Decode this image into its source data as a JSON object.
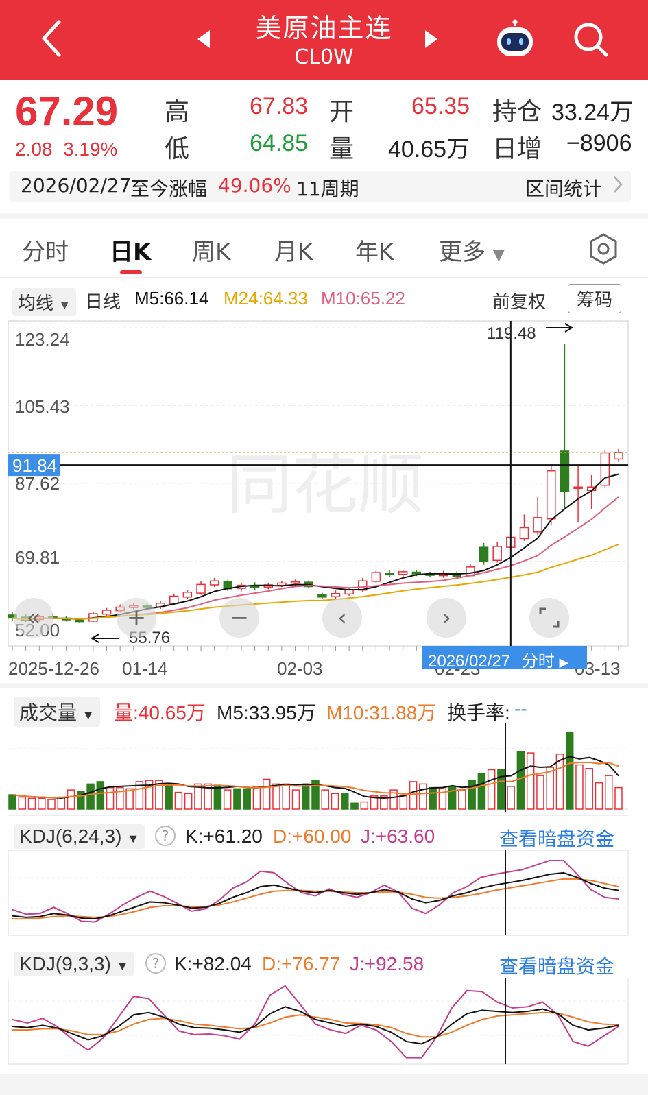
{
  "header": {
    "title": "美原油主连",
    "code": "CL0W"
  },
  "quote": {
    "price": "67.29",
    "change": "2.08",
    "change_pct": "3.19%",
    "high_label": "高",
    "high": "67.83",
    "low_label": "低",
    "low": "64.85",
    "open_label": "开",
    "open": "65.35",
    "volume_label": "量",
    "volume": "40.65万",
    "oi_label": "持仓",
    "oi": "33.24万",
    "daily_inc_label": "日增",
    "daily_inc": "−8906"
  },
  "range_bar": {
    "date": "2026/02/27",
    "label": "至今涨幅",
    "pct": "49.06%",
    "periods": "11周期",
    "stats_link": "区间统计"
  },
  "tabs": [
    "分时",
    "日K",
    "周K",
    "月K",
    "年K",
    "更多"
  ],
  "active_tab": "日K",
  "ma_legend": {
    "selector": "均线",
    "period": "日线",
    "m5": "M5:66.14",
    "m24": "M24:64.33",
    "m10": "M10:65.22",
    "adjust": "前复权",
    "chips": "筹码"
  },
  "colors": {
    "up": "#e8313b",
    "down": "#2e7d1e",
    "m5": "#111111",
    "m10": "#e0607e",
    "m24": "#e6a800",
    "k_line": "#111111",
    "d_line": "#f07a2a",
    "j_line": "#c83c8c",
    "accent_blue": "#3b8fe8"
  },
  "main_chart": {
    "y_ticks": [
      "123.24",
      "105.43",
      "87.62",
      "69.81",
      "52.00"
    ],
    "crosshair_value": "91.84",
    "max_label": "119.48",
    "min_label": "55.76",
    "crosshair_date": "2026/02/27",
    "crosshair_date_suffix": "分时",
    "x_ticks": [
      "2025-12-26",
      "01-14",
      "02-03",
      "02-23",
      "03-13"
    ],
    "watermark": "同花顺"
  },
  "chart_data": {
    "type": "candlestick",
    "ylim": [
      52.0,
      123.24
    ],
    "candles": [
      {
        "o": 57.5,
        "c": 56.8,
        "h": 58.2,
        "l": 56.2
      },
      {
        "o": 57.0,
        "c": 56.2,
        "h": 57.6,
        "l": 55.9
      },
      {
        "o": 56.5,
        "c": 57.1,
        "h": 57.5,
        "l": 56.0
      },
      {
        "o": 57.2,
        "c": 57.0,
        "h": 57.8,
        "l": 56.5
      },
      {
        "o": 56.8,
        "c": 56.4,
        "h": 57.3,
        "l": 56.0
      },
      {
        "o": 56.3,
        "c": 56.0,
        "h": 56.9,
        "l": 55.76
      },
      {
        "o": 56.1,
        "c": 57.8,
        "h": 58.3,
        "l": 55.9
      },
      {
        "o": 57.7,
        "c": 58.6,
        "h": 59.1,
        "l": 57.3
      },
      {
        "o": 58.5,
        "c": 59.3,
        "h": 59.9,
        "l": 58.1
      },
      {
        "o": 59.2,
        "c": 59.6,
        "h": 60.2,
        "l": 58.8
      },
      {
        "o": 59.7,
        "c": 59.2,
        "h": 60.1,
        "l": 58.6
      },
      {
        "o": 59.3,
        "c": 60.2,
        "h": 60.8,
        "l": 58.9
      },
      {
        "o": 60.1,
        "c": 61.8,
        "h": 62.4,
        "l": 59.8
      },
      {
        "o": 61.6,
        "c": 62.7,
        "h": 63.3,
        "l": 61.2
      },
      {
        "o": 62.5,
        "c": 64.5,
        "h": 65.2,
        "l": 62.1
      },
      {
        "o": 64.4,
        "c": 65.3,
        "h": 66.0,
        "l": 63.9
      },
      {
        "o": 65.1,
        "c": 63.5,
        "h": 65.5,
        "l": 63.0
      },
      {
        "o": 63.6,
        "c": 64.3,
        "h": 64.8,
        "l": 62.9
      },
      {
        "o": 64.2,
        "c": 63.8,
        "h": 65.0,
        "l": 63.2
      },
      {
        "o": 63.9,
        "c": 64.4,
        "h": 64.8,
        "l": 63.4
      },
      {
        "o": 64.3,
        "c": 64.8,
        "h": 65.3,
        "l": 63.9
      },
      {
        "o": 64.9,
        "c": 65.1,
        "h": 65.6,
        "l": 64.2
      },
      {
        "o": 65.0,
        "c": 64.0,
        "h": 65.4,
        "l": 63.6
      },
      {
        "o": 62.2,
        "c": 61.6,
        "h": 62.6,
        "l": 61.1
      },
      {
        "o": 61.7,
        "c": 62.4,
        "h": 63.1,
        "l": 61.2
      },
      {
        "o": 62.3,
        "c": 63.3,
        "h": 63.9,
        "l": 61.9
      },
      {
        "o": 63.2,
        "c": 65.3,
        "h": 66.0,
        "l": 62.8
      },
      {
        "o": 65.2,
        "c": 67.2,
        "h": 67.8,
        "l": 64.8
      },
      {
        "o": 67.1,
        "c": 66.7,
        "h": 67.8,
        "l": 66.2
      },
      {
        "o": 66.8,
        "c": 67.4,
        "h": 67.9,
        "l": 66.2
      },
      {
        "o": 67.3,
        "c": 66.9,
        "h": 67.8,
        "l": 66.4
      },
      {
        "o": 66.9,
        "c": 66.6,
        "h": 67.4,
        "l": 66.1
      },
      {
        "o": 66.5,
        "c": 67.0,
        "h": 67.6,
        "l": 66.0
      },
      {
        "o": 67.0,
        "c": 66.4,
        "h": 67.5,
        "l": 65.9
      },
      {
        "o": 66.5,
        "c": 68.5,
        "h": 69.2,
        "l": 66.3
      },
      {
        "o": 73.0,
        "c": 69.8,
        "h": 74.0,
        "l": 69.0
      },
      {
        "o": 70.0,
        "c": 73.2,
        "h": 74.3,
        "l": 69.5
      },
      {
        "o": 73.0,
        "c": 75.3,
        "h": 78.5,
        "l": 72.5
      },
      {
        "o": 75.0,
        "c": 77.5,
        "h": 80.5,
        "l": 74.5
      },
      {
        "o": 76.5,
        "c": 79.8,
        "h": 84.5,
        "l": 75.8
      },
      {
        "o": 79.5,
        "c": 90.5,
        "h": 91.6,
        "l": 78.0
      },
      {
        "o": 95.0,
        "c": 85.8,
        "h": 119.48,
        "l": 82.0
      },
      {
        "o": 86.5,
        "c": 86.8,
        "h": 91.8,
        "l": 78.7
      },
      {
        "o": 86.0,
        "c": 86.8,
        "h": 89.5,
        "l": 81.8
      },
      {
        "o": 87.2,
        "c": 94.6,
        "h": 95.3,
        "l": 86.5
      },
      {
        "o": 93.2,
        "c": 94.7,
        "h": 95.5,
        "l": 92.5
      }
    ],
    "volume": [
      {
        "v": 1.2,
        "up": false
      },
      {
        "v": 1.0,
        "up": true
      },
      {
        "v": 0.9,
        "up": true
      },
      {
        "v": 0.9,
        "up": true
      },
      {
        "v": 0.8,
        "up": true
      },
      {
        "v": 1.0,
        "up": true
      },
      {
        "v": 1.6,
        "up": true
      },
      {
        "v": 1.5,
        "up": false
      },
      {
        "v": 2.1,
        "up": false
      },
      {
        "v": 2.3,
        "up": false
      },
      {
        "v": 1.8,
        "up": true
      },
      {
        "v": 1.8,
        "up": true
      },
      {
        "v": 1.7,
        "up": true
      },
      {
        "v": 2.3,
        "up": true
      },
      {
        "v": 2.4,
        "up": true
      },
      {
        "v": 2.4,
        "up": true
      },
      {
        "v": 2.0,
        "up": false
      },
      {
        "v": 1.4,
        "up": true
      },
      {
        "v": 1.3,
        "up": true
      },
      {
        "v": 2.1,
        "up": true
      },
      {
        "v": 2.1,
        "up": true
      },
      {
        "v": 2.0,
        "up": false
      },
      {
        "v": 1.6,
        "up": true
      },
      {
        "v": 1.7,
        "up": false
      },
      {
        "v": 1.7,
        "up": false
      },
      {
        "v": 1.9,
        "up": true
      },
      {
        "v": 2.5,
        "up": true
      },
      {
        "v": 2.1,
        "up": true
      },
      {
        "v": 2.1,
        "up": true
      },
      {
        "v": 1.6,
        "up": true
      },
      {
        "v": 2.1,
        "up": false
      },
      {
        "v": 2.4,
        "up": false
      },
      {
        "v": 1.6,
        "up": true
      },
      {
        "v": 1.3,
        "up": true
      },
      {
        "v": 1.3,
        "up": false
      },
      {
        "v": 0.5,
        "up": false
      },
      {
        "v": 0.6,
        "up": true
      },
      {
        "v": 1.1,
        "up": true
      },
      {
        "v": 1.1,
        "up": true
      },
      {
        "v": 1.6,
        "up": true
      },
      {
        "v": 1.1,
        "up": true
      },
      {
        "v": 2.3,
        "up": true
      },
      {
        "v": 2.1,
        "up": true
      },
      {
        "v": 1.8,
        "up": false
      },
      {
        "v": 1.7,
        "up": true
      },
      {
        "v": 1.9,
        "up": false
      },
      {
        "v": 1.6,
        "up": true
      },
      {
        "v": 2.4,
        "up": false
      },
      {
        "v": 3.0,
        "up": false
      },
      {
        "v": 3.3,
        "up": true
      },
      {
        "v": 3.3,
        "up": false
      },
      {
        "v": 1.9,
        "up": true
      },
      {
        "v": 4.8,
        "up": false
      },
      {
        "v": 4.7,
        "up": true
      },
      {
        "v": 2.8,
        "up": true
      },
      {
        "v": 3.5,
        "up": true
      },
      {
        "v": 4.6,
        "up": true
      },
      {
        "v": 6.4,
        "up": false
      },
      {
        "v": 3.7,
        "up": true
      },
      {
        "v": 3.4,
        "up": true
      },
      {
        "v": 2.2,
        "up": true
      },
      {
        "v": 2.8,
        "up": true
      },
      {
        "v": 1.8,
        "up": true
      }
    ],
    "kdj1": {
      "k": [
        30,
        28,
        29,
        33,
        31,
        27,
        26,
        30,
        36,
        42,
        48,
        47,
        44,
        40,
        41,
        46,
        54,
        60,
        68,
        70,
        66,
        62,
        60,
        63,
        60,
        58,
        60,
        64,
        61,
        52,
        47,
        50,
        56,
        60,
        66,
        70,
        73,
        76,
        80,
        84,
        86,
        80,
        72,
        66,
        63
      ],
      "d": [
        26,
        26,
        27,
        29,
        30,
        29,
        28,
        29,
        32,
        36,
        41,
        43,
        43,
        42,
        42,
        44,
        48,
        53,
        58,
        62,
        63,
        63,
        62,
        62,
        61,
        60,
        60,
        61,
        61,
        58,
        54,
        53,
        54,
        56,
        59,
        63,
        66,
        69,
        72,
        75,
        78,
        78,
        76,
        72,
        68
      ],
      "j": [
        38,
        32,
        33,
        41,
        33,
        23,
        22,
        32,
        44,
        54,
        62,
        55,
        46,
        36,
        39,
        50,
        66,
        74,
        88,
        86,
        72,
        60,
        56,
        65,
        58,
        54,
        60,
        70,
        61,
        40,
        33,
        44,
        60,
        68,
        80,
        84,
        87,
        90,
        96,
        102,
        102,
        84,
        64,
        54,
        52
      ]
    },
    "kdj2": {
      "k": [
        58,
        56,
        60,
        55,
        45,
        35,
        42,
        58,
        78,
        82,
        74,
        62,
        56,
        55,
        52,
        48,
        58,
        80,
        92,
        84,
        70,
        64,
        58,
        62,
        58,
        48,
        32,
        28,
        40,
        62,
        80,
        86,
        84,
        82,
        84,
        88,
        80,
        60,
        52,
        55,
        60
      ],
      "d": [
        52,
        52,
        54,
        54,
        50,
        44,
        44,
        50,
        62,
        70,
        72,
        68,
        62,
        60,
        57,
        54,
        56,
        64,
        74,
        78,
        74,
        70,
        64,
        63,
        61,
        56,
        46,
        40,
        40,
        48,
        60,
        70,
        76,
        78,
        80,
        82,
        81,
        74,
        66,
        62,
        61
      ],
      "j": [
        70,
        64,
        72,
        57,
        35,
        17,
        38,
        74,
        110,
        106,
        78,
        50,
        44,
        45,
        42,
        36,
        62,
        112,
        128,
        96,
        62,
        52,
        46,
        60,
        52,
        32,
        4,
        4,
        40,
        90,
        120,
        118,
        100,
        90,
        92,
        100,
        78,
        32,
        24,
        41,
        58
      ]
    }
  },
  "volume_panel": {
    "selector": "成交量",
    "vol": "量:40.65万",
    "m5": "M5:33.95万",
    "m10": "M10:31.88万",
    "turnover_label": "换手率:",
    "turnover_value": "--"
  },
  "kdj_panel_1": {
    "selector": "KDJ(6,24,3)",
    "k": "K:+61.20",
    "d": "D:+60.00",
    "j": "J:+63.60",
    "link": "查看暗盘资金"
  },
  "kdj_panel_2": {
    "selector": "KDJ(9,3,3)",
    "k": "K:+82.04",
    "d": "D:+76.77",
    "j": "J:+92.58",
    "link": "查看暗盘资金"
  },
  "icons": [
    "back-arrow-icon",
    "prev-icon",
    "next-icon",
    "robot-icon",
    "search-icon",
    "settings-icon",
    "help-icon"
  ]
}
